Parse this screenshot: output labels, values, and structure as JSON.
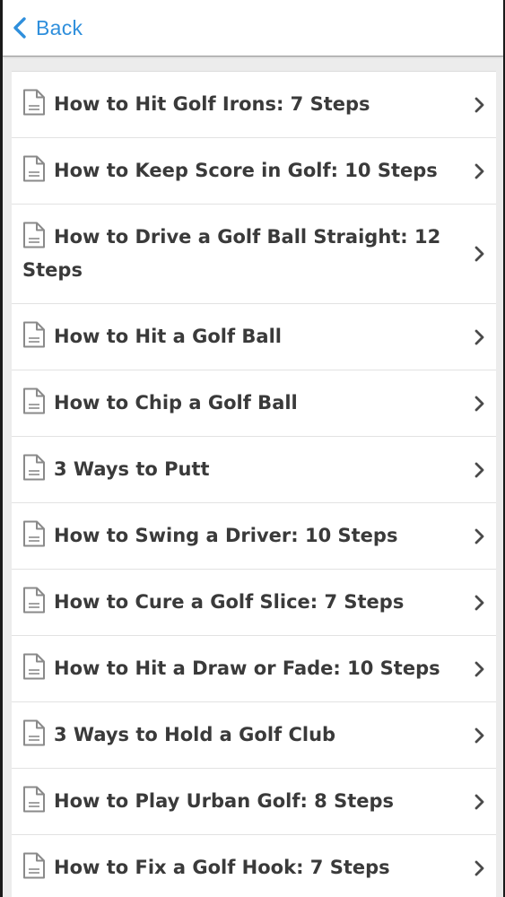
{
  "header": {
    "back_label": "Back",
    "accent_color": "#2f8fdc"
  },
  "list": {
    "items": [
      {
        "label": "How to Hit Golf Irons: 7 Steps",
        "icon": "document-icon"
      },
      {
        "label": "How to Keep Score in Golf: 10 Steps",
        "icon": "document-icon"
      },
      {
        "label": "How to Drive a Golf Ball Straight: 12 Steps",
        "icon": "document-icon"
      },
      {
        "label": "How to Hit a Golf Ball",
        "icon": "document-icon"
      },
      {
        "label": "How to Chip a Golf Ball",
        "icon": "document-icon"
      },
      {
        "label": "3 Ways to Putt",
        "icon": "document-icon"
      },
      {
        "label": "How to Swing a Driver: 10 Steps",
        "icon": "document-icon"
      },
      {
        "label": "How to Cure a Golf Slice: 7 Steps",
        "icon": "document-icon"
      },
      {
        "label": "How to Hit a Draw or Fade: 10 Steps",
        "icon": "document-icon"
      },
      {
        "label": "3 Ways to Hold a Golf Club",
        "icon": "document-icon"
      },
      {
        "label": "How to Play Urban Golf: 8 Steps",
        "icon": "document-icon"
      },
      {
        "label": "How to Fix a Golf Hook: 7 Steps",
        "icon": "document-icon"
      }
    ]
  }
}
